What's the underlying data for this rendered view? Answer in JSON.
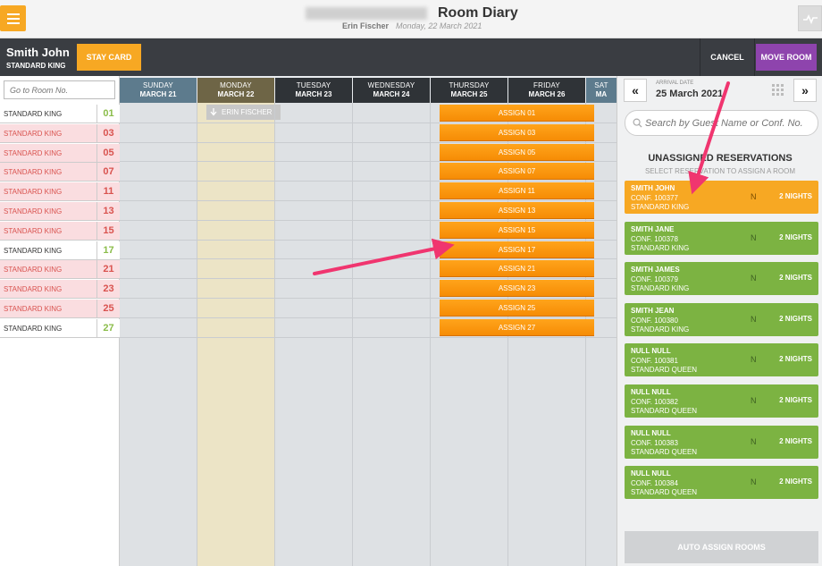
{
  "header": {
    "title": "Room Diary",
    "user": "Erin Fischer",
    "date": "Monday, 22 March 2021"
  },
  "guest": {
    "name": "Smith John",
    "room_type": "STANDARD KING",
    "stay_card_label": "STAY CARD",
    "cancel_label": "CANCEL",
    "move_room_label": "MOVE ROOM"
  },
  "room_search_placeholder": "Go to Room No.",
  "days": [
    {
      "name": "SUNDAY",
      "date": "MARCH 21"
    },
    {
      "name": "MONDAY",
      "date": "MARCH 22"
    },
    {
      "name": "TUESDAY",
      "date": "MARCH 23"
    },
    {
      "name": "WEDNESDAY",
      "date": "MARCH 24"
    },
    {
      "name": "THURSDAY",
      "date": "MARCH 25"
    },
    {
      "name": "FRIDAY",
      "date": "MARCH 26"
    },
    {
      "name": "SAT",
      "date": "MA"
    }
  ],
  "rooms": [
    {
      "type": "STANDARD KING",
      "number": "01",
      "status": "clean"
    },
    {
      "type": "STANDARD KING",
      "number": "03",
      "status": "dirty"
    },
    {
      "type": "STANDARD KING",
      "number": "05",
      "status": "dirty"
    },
    {
      "type": "STANDARD KING",
      "number": "07",
      "status": "dirty"
    },
    {
      "type": "STANDARD KING",
      "number": "11",
      "status": "dirty"
    },
    {
      "type": "STANDARD KING",
      "number": "13",
      "status": "dirty"
    },
    {
      "type": "STANDARD KING",
      "number": "15",
      "status": "dirty"
    },
    {
      "type": "STANDARD KING",
      "number": "17",
      "status": "clean"
    },
    {
      "type": "STANDARD KING",
      "number": "21",
      "status": "dirty"
    },
    {
      "type": "STANDARD KING",
      "number": "23",
      "status": "dirty"
    },
    {
      "type": "STANDARD KING",
      "number": "25",
      "status": "dirty"
    },
    {
      "type": "STANDARD KING",
      "number": "27",
      "status": "clean"
    }
  ],
  "assign_labels": [
    "ASSIGN 01",
    "ASSIGN 03",
    "ASSIGN 05",
    "ASSIGN 07",
    "ASSIGN 11",
    "ASSIGN 13",
    "ASSIGN 15",
    "ASSIGN 17",
    "ASSIGN 21",
    "ASSIGN 23",
    "ASSIGN 25",
    "ASSIGN 27"
  ],
  "occupied_chip": "ERIN FISCHER",
  "right_panel": {
    "arrival_label": "ARRIVAL DATE",
    "arrival_date": "25 March 2021",
    "search_placeholder": "Search by Guest Name or Conf. No.",
    "unassigned_title": "UNASSIGNED RESERVATIONS",
    "unassigned_sub": "SELECT RESERVATION TO ASSIGN A ROOM",
    "auto_assign_label": "AUTO ASSIGN ROOMS"
  },
  "reservations": [
    {
      "name": "SMITH JOHN",
      "conf": "CONF. 100377",
      "type": "STANDARD KING",
      "flag": "N",
      "nights": "2 NIGHTS",
      "selected": true
    },
    {
      "name": "SMITH JANE",
      "conf": "CONF. 100378",
      "type": "STANDARD KING",
      "flag": "N",
      "nights": "2 NIGHTS",
      "selected": false
    },
    {
      "name": "SMITH JAMES",
      "conf": "CONF. 100379",
      "type": "STANDARD KING",
      "flag": "N",
      "nights": "2 NIGHTS",
      "selected": false
    },
    {
      "name": "SMITH JEAN",
      "conf": "CONF. 100380",
      "type": "STANDARD KING",
      "flag": "N",
      "nights": "2 NIGHTS",
      "selected": false
    },
    {
      "name": "NULL NULL",
      "conf": "CONF. 100381",
      "type": "STANDARD QUEEN",
      "flag": "N",
      "nights": "2 NIGHTS",
      "selected": false
    },
    {
      "name": "NULL NULL",
      "conf": "CONF. 100382",
      "type": "STANDARD QUEEN",
      "flag": "N",
      "nights": "2 NIGHTS",
      "selected": false
    },
    {
      "name": "NULL NULL",
      "conf": "CONF. 100383",
      "type": "STANDARD QUEEN",
      "flag": "N",
      "nights": "2 NIGHTS",
      "selected": false
    },
    {
      "name": "NULL NULL",
      "conf": "CONF. 100384",
      "type": "STANDARD QUEEN",
      "flag": "N",
      "nights": "2 NIGHTS",
      "selected": false
    }
  ],
  "colors": {
    "accent_orange": "#f7a823",
    "move_room_purple": "#8e44ad",
    "reservation_green": "#7cb342",
    "annotation_pink": "#f0356f"
  }
}
